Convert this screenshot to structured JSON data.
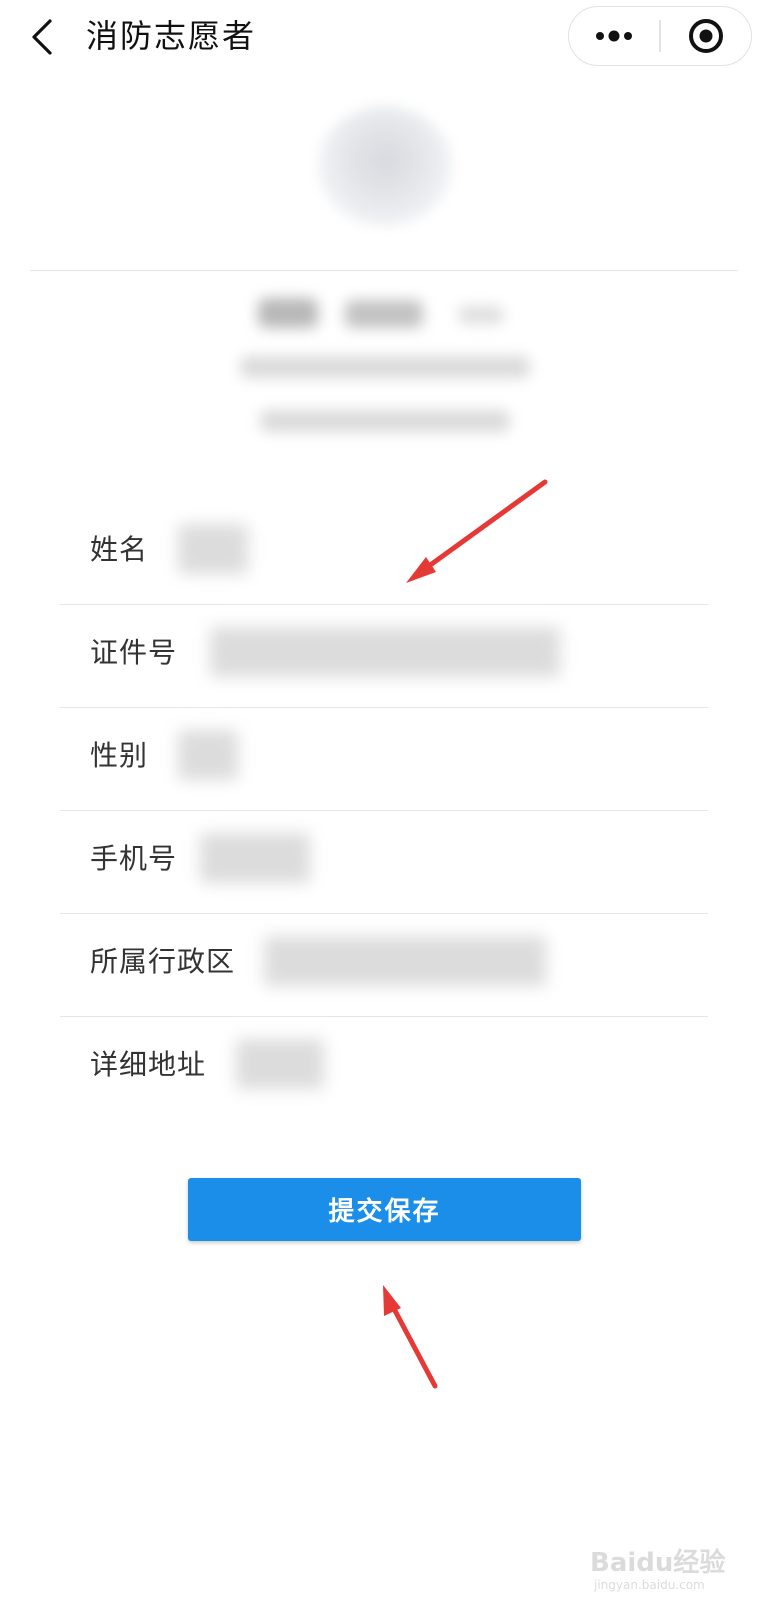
{
  "navbar": {
    "title": "消防志愿者"
  },
  "form": {
    "fields": [
      {
        "label": "姓名"
      },
      {
        "label": "证件号"
      },
      {
        "label": "性别"
      },
      {
        "label": "手机号"
      },
      {
        "label": "所属行政区"
      },
      {
        "label": "详细地址"
      }
    ]
  },
  "actions": {
    "submit_label": "提交保存"
  },
  "colors": {
    "primary_button": "#1a8ee8",
    "annotation_arrow": "#e53935"
  },
  "icons": {
    "back": "chevron-left-icon",
    "more": "more-dots-icon",
    "close": "target-circle-icon"
  },
  "watermark": {
    "main": "Baidu经验",
    "sub": "jingyan.baidu.com"
  }
}
